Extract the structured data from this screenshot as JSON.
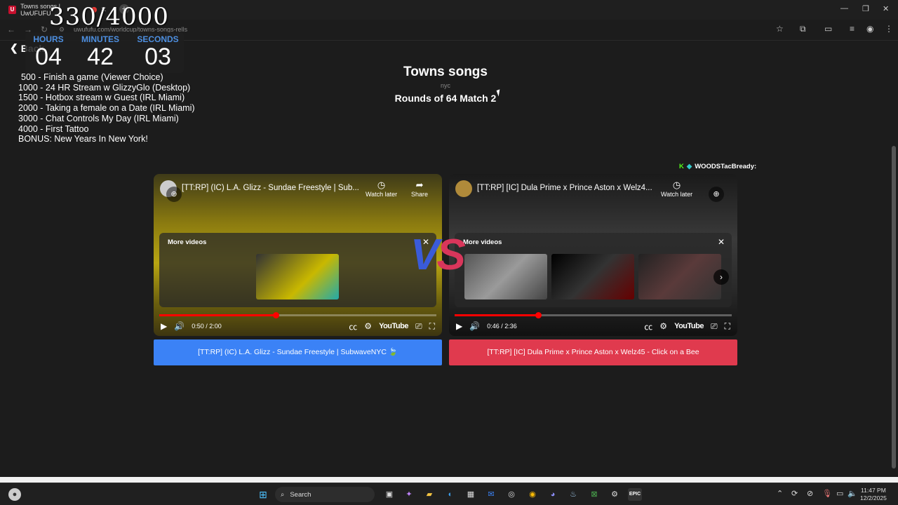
{
  "browser": {
    "tab_title": "Towns songs | UwUFUFU",
    "tab_favicon": "U",
    "url": "uwufufu.com/worldcup/towns-songs-rells",
    "new_tab": "+",
    "win_min": "—",
    "win_max": "❐",
    "win_close": "✕"
  },
  "overlay": {
    "counter": "330/4000",
    "timer": {
      "hours_label": "HOURS",
      "hours": "04",
      "minutes_label": "MINUTES",
      "minutes": "42",
      "seconds_label": "SECONDS",
      "seconds": "03"
    },
    "goals": [
      "500 -  Finish a game (Viewer Choice)",
      "1000 - 24 HR Stream w GlizzyGlo (Desktop)",
      "1500 - Hotbox stream w Guest (IRL Miami)",
      "2000 - Taking a female on a Date (IRL Miami)",
      "3000 - Chat Controls My Day (IRL Miami)",
      "4000 - First Tattoo",
      "BONUS: New Years In New York!"
    ],
    "viewer_name": "WOODSTacBready:"
  },
  "page": {
    "back_label": "Back",
    "title": "Towns songs",
    "subtitle": "nyc",
    "round": "Rounds of 64 Match 2",
    "vs": {
      "v": "V",
      "s": "S"
    }
  },
  "videos": [
    {
      "title": "[TT:RP] (IC) L.A. Glizz - Sundae Freestyle | Sub...",
      "watch_later": "Watch later",
      "share": "Share",
      "more_videos": "More videos",
      "time": "0:50 / 2:00",
      "progress": 0.42,
      "choice": "[TT:RP] (IC) L.A. Glizz - Sundae Freestyle | SubwaveNYC 🍃"
    },
    {
      "title": "[TT:RP] [IC] Dula Prime x Prince Aston x Welz4...",
      "watch_later": "Watch later",
      "more_videos": "More videos",
      "time": "0:46 / 2:36",
      "progress": 0.3,
      "choice": "[TT:RP] [IC] Dula Prime x Prince Aston x Welz45 - Click on a Bee"
    }
  ],
  "youtube_label": "YouTube",
  "taskbar": {
    "search_label": "Search",
    "time": "11:47 PM",
    "date": "12/2/2025",
    "epic_label": "EPIC"
  },
  "colors": {
    "left_choice": "#3b82f6",
    "right_choice": "#e03a4e",
    "timer_label": "#4d8fe0"
  }
}
